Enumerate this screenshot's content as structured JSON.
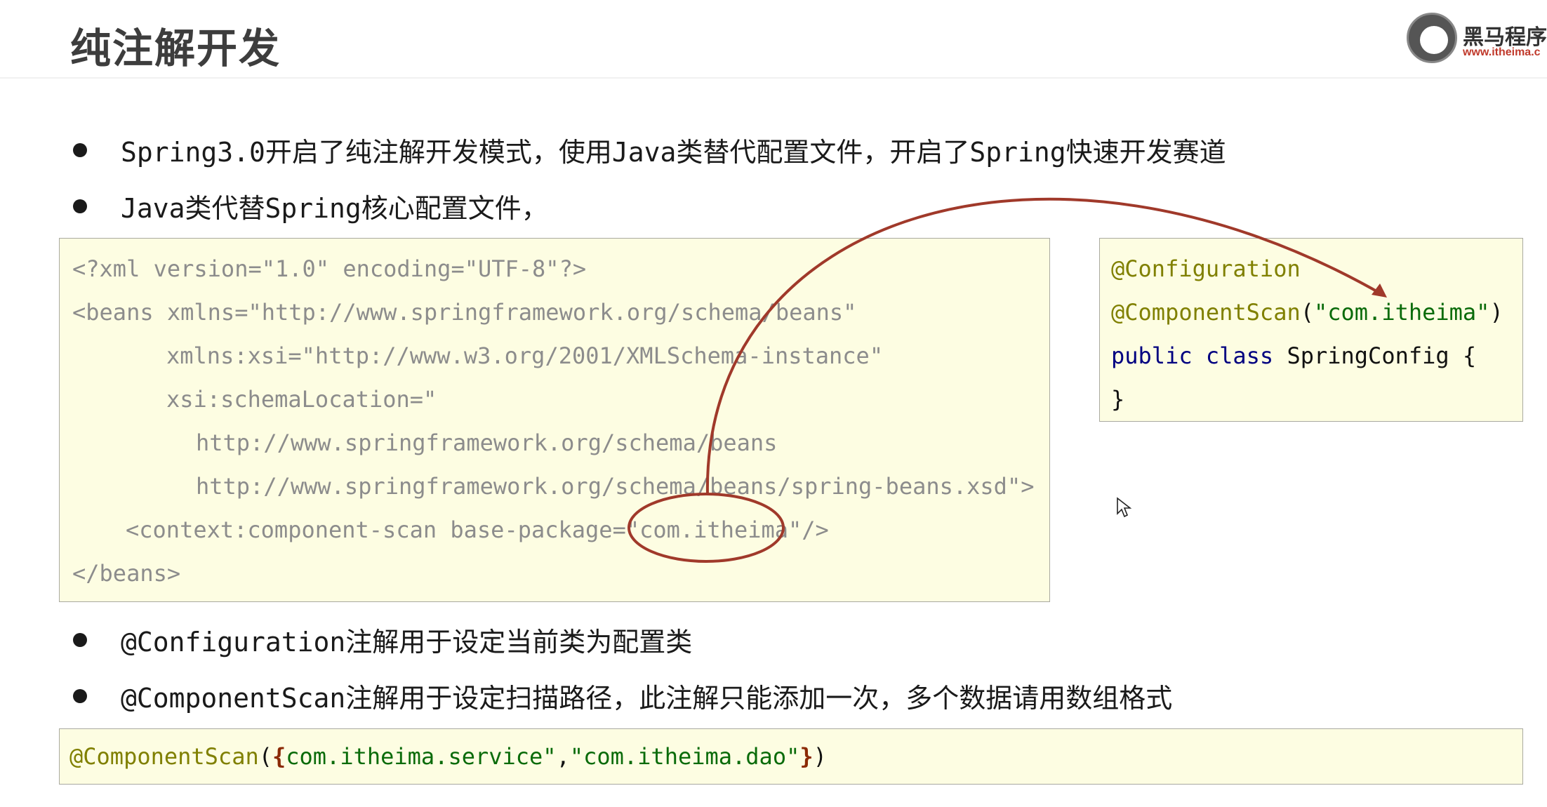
{
  "title": "纯注解开发",
  "logo": {
    "text": "黑马程序",
    "url": "www.itheima.c"
  },
  "bullets_top": [
    "Spring3.0开启了纯注解开发模式，使用Java类替代配置文件，开启了Spring快速开发赛道",
    "Java类代替Spring核心配置文件，"
  ],
  "xml_code": {
    "lines": [
      "<?xml version=\"1.0\" encoding=\"UTF-8\"?>",
      "<beans xmlns=\"http://www.springframework.org/schema/beans\"",
      "xmlns:xsi=\"http://www.w3.org/2001/XMLSchema-instance\"",
      "xsi:schemaLocation=\"",
      "http://www.springframework.org/schema/beans",
      "http://www.springframework.org/schema/beans/spring-beans.xsd\">",
      "<context:component-scan base-package=\"com.itheima\"/>",
      "</beans>"
    ]
  },
  "java_code": {
    "annotation1": "@Configuration",
    "annotation2": "@ComponentScan",
    "annotation2_open": "(",
    "annotation2_arg": "\"com.itheima\"",
    "annotation2_close": ")",
    "kw_public": "public",
    "kw_class": "class",
    "class_decl": " SpringConfig {",
    "close": "}"
  },
  "bullets_bottom": [
    "@Configuration注解用于设定当前类为配置类",
    "@ComponentScan注解用于设定扫描路径，此注解只能添加一次，多个数据请用数组格式"
  ],
  "bottom_code": {
    "annotation": "@ComponentScan",
    "paren_open": "(",
    "brace_open": "{",
    "arg1": "com.itheima.service\"",
    "comma": ",",
    "arg2": "\"com.itheima.dao\"",
    "brace_close": "}",
    "paren_close": ")"
  },
  "colors": {
    "highlight_arrow": "#a0392a",
    "code_bg": "#fdfde2"
  }
}
